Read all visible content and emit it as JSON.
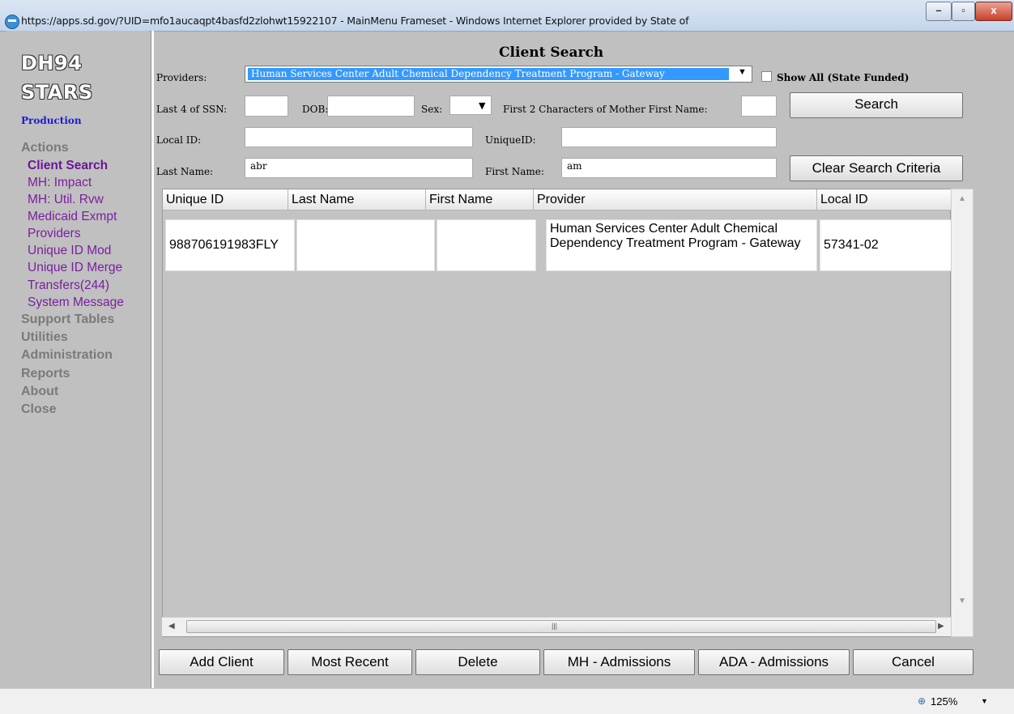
{
  "window": {
    "title": "https://apps.sd.gov/?UID=mfo1aucaqpt4basfd2zlohwt15922107 - MainMenu Frameset - Windows Internet Explorer provided by State of",
    "minimize": "–",
    "restore": "▫",
    "close": "x"
  },
  "sidebar": {
    "logo_line1": "DH94",
    "logo_line2": "STARS",
    "environment": "Production",
    "sections": [
      {
        "label": "Actions"
      },
      {
        "label": "Support Tables"
      },
      {
        "label": "Utilities"
      },
      {
        "label": "Administration"
      },
      {
        "label": "Reports"
      },
      {
        "label": "About"
      },
      {
        "label": "Close"
      }
    ],
    "action_items": [
      {
        "label": "Client Search"
      },
      {
        "label": "MH: Impact"
      },
      {
        "label": "MH: Util. Rvw"
      },
      {
        "label": "Medicaid Exmpt"
      },
      {
        "label": "Providers"
      },
      {
        "label": "Unique ID Mod"
      },
      {
        "label": "Unique ID Merge"
      },
      {
        "label": "Transfers(244)"
      },
      {
        "label": "System Message"
      }
    ]
  },
  "form": {
    "heading": "Client Search",
    "providers_label": "Providers:",
    "providers_value": "Human Services Center Adult Chemical Dependency Treatment Program - Gateway",
    "show_all_label": "Show All (State Funded)",
    "ssn_label": "Last 4 of SSN:",
    "ssn_value": "",
    "dob_label": "DOB:",
    "dob_value": "",
    "sex_label": "Sex:",
    "sex_value": "",
    "mother_label": "First 2 Characters of Mother First Name:",
    "mother_value": "",
    "search_button": "Search",
    "local_id_label": "Local ID:",
    "local_id_value": "",
    "unique_id_label": "UniqueID:",
    "unique_id_value": "",
    "last_name_label": "Last Name:",
    "last_name_value": "abr",
    "first_name_label": "First Name:",
    "first_name_value": "am",
    "clear_button": "Clear Search Criteria"
  },
  "grid": {
    "columns": [
      "Unique ID",
      "Last Name",
      "First Name",
      "Provider",
      "Local ID"
    ],
    "rows": [
      {
        "unique_id": "988706191983FLY",
        "last_name": "",
        "first_name": "",
        "provider": "Human Services Center Adult Chemical Dependency Treatment Program - Gateway",
        "local_id": "57341-02"
      }
    ]
  },
  "buttons": {
    "add_client": "Add Client",
    "most_recent": "Most Recent",
    "delete": "Delete",
    "mh_admissions": "MH - Admissions",
    "ada_admissions": "ADA - Admissions",
    "cancel": "Cancel"
  },
  "status": {
    "zoom": "125%"
  }
}
